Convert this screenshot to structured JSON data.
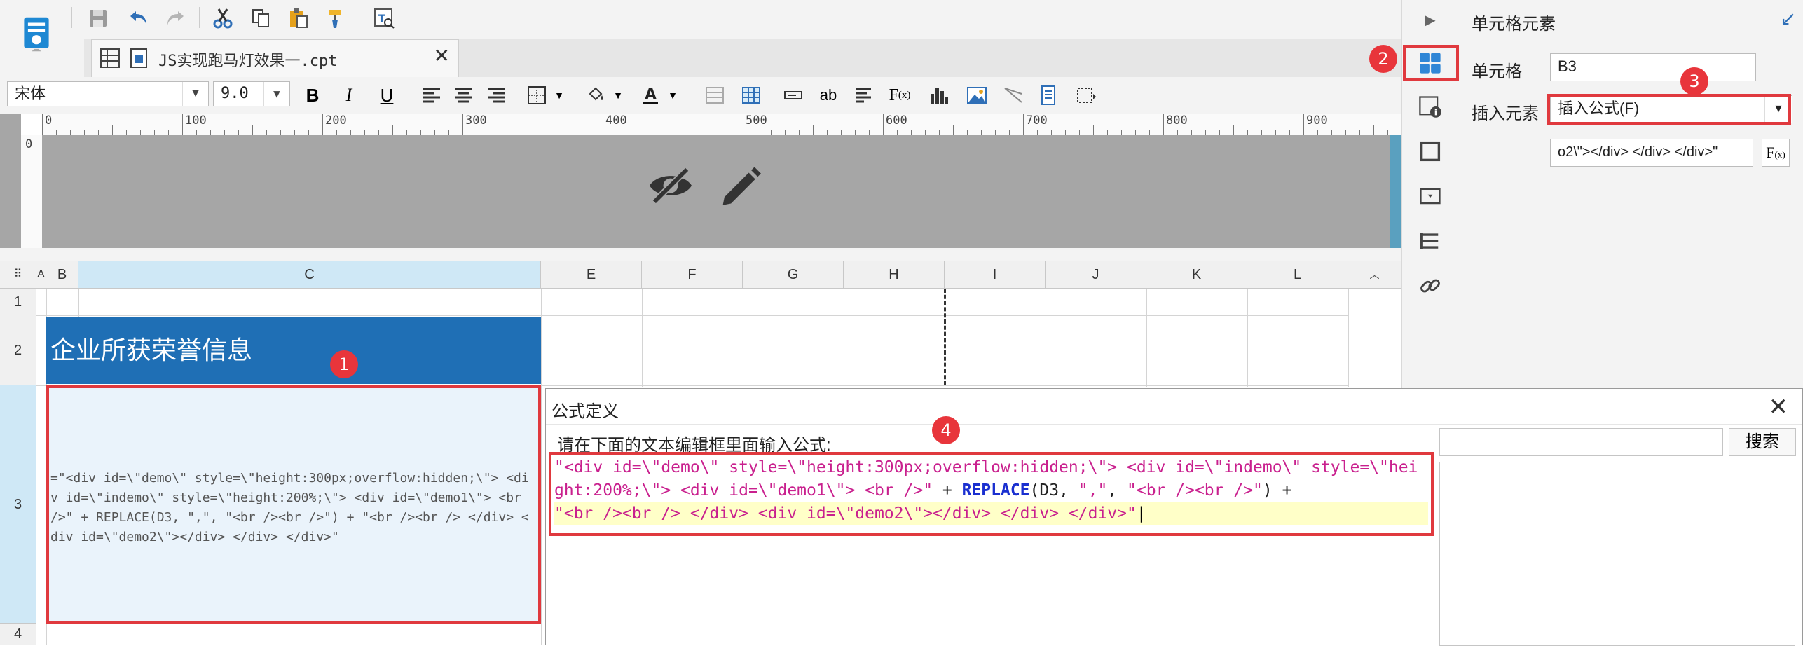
{
  "toolbar": {
    "file_tab_label": "JS实现跑马灯效果一.cpt",
    "font_name": "宋体",
    "font_size": "9.0"
  },
  "ruler": {
    "ticks": [
      "0",
      "100",
      "200",
      "300",
      "400",
      "500",
      "600",
      "700",
      "800",
      "900"
    ],
    "left_tick": "0"
  },
  "grid": {
    "columns": [
      "A",
      "B",
      "C",
      "E",
      "F",
      "G",
      "H",
      "I",
      "J",
      "K",
      "L"
    ],
    "rows": [
      "1",
      "2",
      "3",
      "4"
    ],
    "title_text": "企业所获荣誉信息",
    "b3_text": "=\"<div id=\\\"demo\\\" style=\\\"height:300px;overflow:hidden;\\\"> <div id=\\\"indemo\\\" style=\\\"height:200%;\\\"> <div id=\\\"demo1\\\"> <br />\" + REPLACE(D3, \",\", \"<br /><br />\") + \"<br /><br /> </div> <div id=\\\"demo2\\\"></div> </div> </div>\""
  },
  "right_panel": {
    "title": "单元格元素",
    "cell_label": "单元格",
    "cell_value": "B3",
    "insert_label": "插入元素",
    "insert_value": "插入公式(F)",
    "formula_preview": "o2\\\"></div> </div> </div>\""
  },
  "dialog": {
    "title": "公式定义",
    "prompt": "请在下面的文本编辑框里面输入公式:",
    "search_button": "搜索",
    "formula_lines": [
      [
        {
          "t": "s",
          "v": "\"<div id=\\\"demo\\\" style=\\\"height:300px;overflow:hidden;\\\"> <div id=\\\"indemo\\\" style=\\\"hei"
        }
      ],
      [
        {
          "t": "s",
          "v": "ght:200%;\\\"> <div id=\\\"demo1\\\"> <br />\""
        },
        {
          "t": "n",
          "v": " + "
        },
        {
          "t": "k",
          "v": "REPLACE"
        },
        {
          "t": "n",
          "v": "(D3, "
        },
        {
          "t": "s",
          "v": "\",\""
        },
        {
          "t": "n",
          "v": ", "
        },
        {
          "t": "s",
          "v": "\"<br /><br />\""
        },
        {
          "t": "n",
          "v": ") +"
        }
      ],
      [
        {
          "t": "s",
          "v": "\"<br /><br /> </div> <div id=\\\"demo2\\\"></div> </div> </div>\""
        }
      ]
    ]
  },
  "badges": [
    "1",
    "2",
    "3",
    "4"
  ],
  "colors": {
    "accent_red": "#e0393e",
    "title_blue": "#1f6fb5",
    "selection": "#cfe8f6"
  }
}
